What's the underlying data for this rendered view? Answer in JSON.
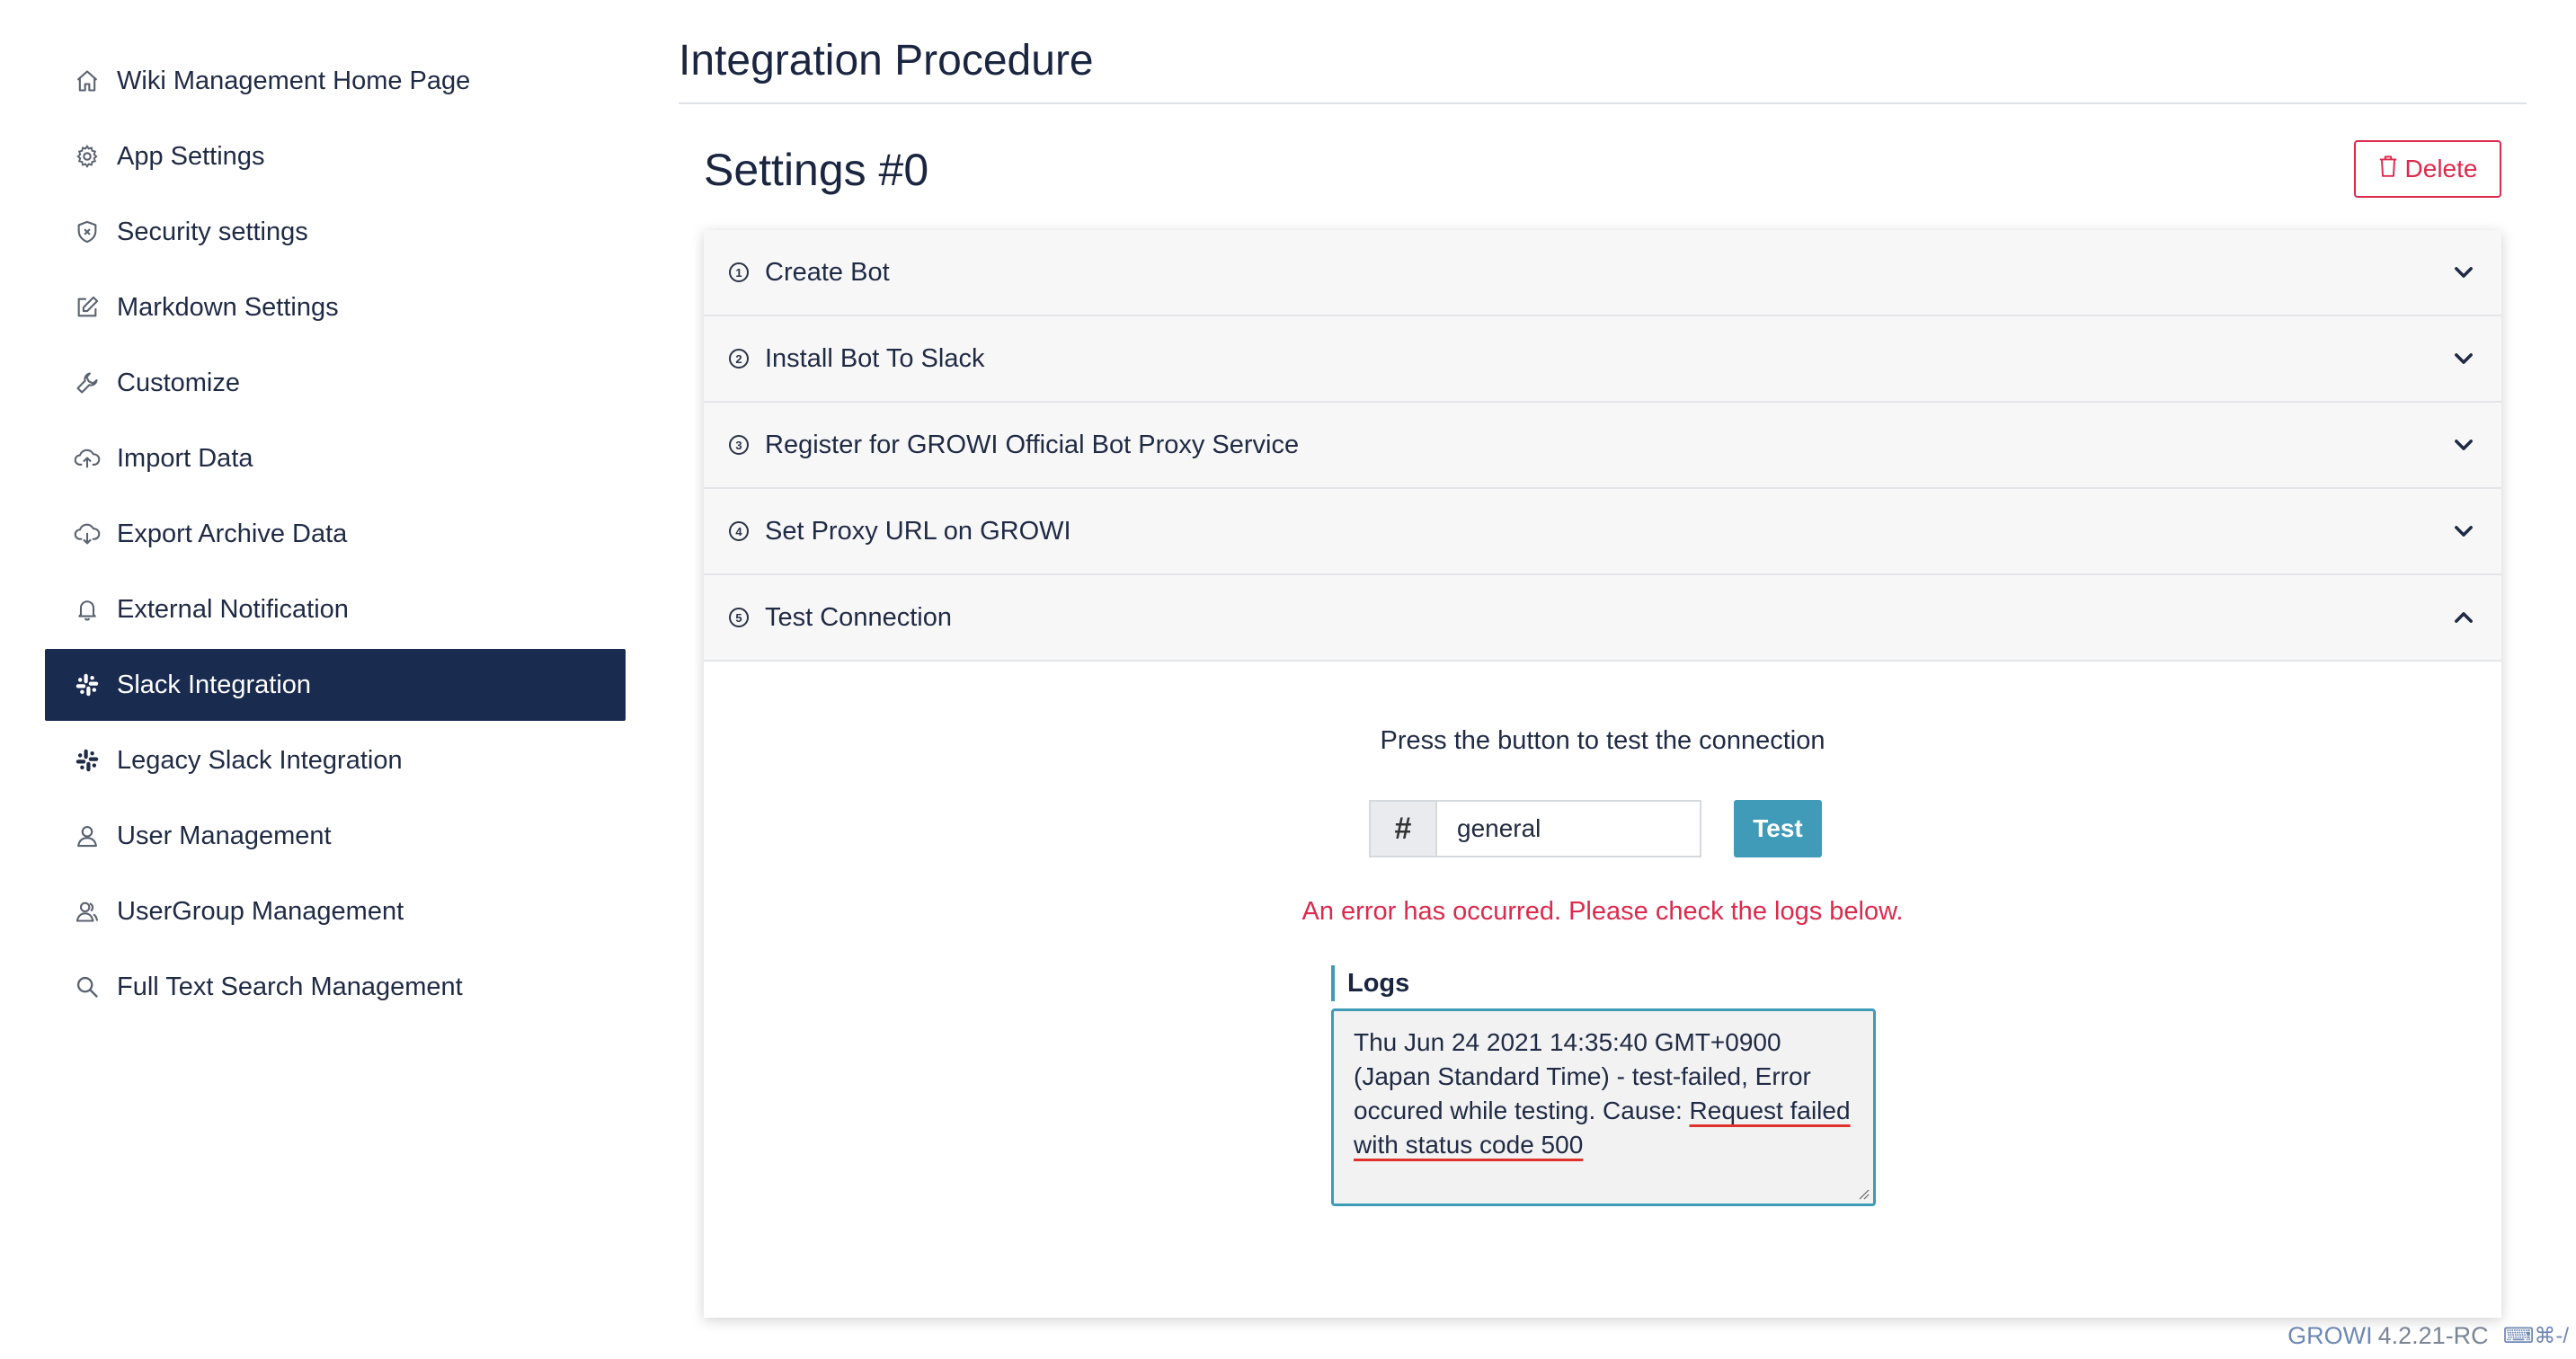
{
  "sidebar": {
    "items": [
      {
        "label": "Wiki Management Home Page",
        "icon": "home-icon"
      },
      {
        "label": "App Settings",
        "icon": "gear-icon"
      },
      {
        "label": "Security settings",
        "icon": "shield-icon"
      },
      {
        "label": "Markdown Settings",
        "icon": "edit-icon"
      },
      {
        "label": "Customize",
        "icon": "wrench-icon"
      },
      {
        "label": "Import Data",
        "icon": "cloud-upload-icon"
      },
      {
        "label": "Export Archive Data",
        "icon": "cloud-download-icon"
      },
      {
        "label": "External Notification",
        "icon": "bell-icon"
      },
      {
        "label": "Slack Integration",
        "icon": "slack-icon",
        "active": true
      },
      {
        "label": "Legacy Slack Integration",
        "icon": "slack-icon"
      },
      {
        "label": "User Management",
        "icon": "user-icon"
      },
      {
        "label": "UserGroup Management",
        "icon": "users-icon"
      },
      {
        "label": "Full Text Search Management",
        "icon": "search-icon"
      }
    ]
  },
  "main": {
    "title": "Integration Procedure",
    "settings_title": "Settings #0",
    "delete_label": "Delete",
    "steps": [
      {
        "number": "1",
        "label": "Create Bot",
        "expanded": false
      },
      {
        "number": "2",
        "label": "Install Bot To Slack",
        "expanded": false
      },
      {
        "number": "3",
        "label": "Register for GROWI Official Bot Proxy Service",
        "expanded": false
      },
      {
        "number": "4",
        "label": "Set Proxy URL on GROWI",
        "expanded": false
      },
      {
        "number": "5",
        "label": "Test Connection",
        "expanded": true
      }
    ],
    "test_connection": {
      "instruction": "Press the button to test the connection",
      "hash_symbol": "#",
      "channel_value": "general",
      "test_label": "Test",
      "error_message": "An error has occurred. Please check the logs below.",
      "logs_label": "Logs",
      "log_text_prefix": "Thu Jun 24 2021 14:35:40 GMT+0900 (Japan Standard Time) - test-failed, Error occured while testing. Cause: ",
      "log_text_error": "Request failed with status code 500"
    }
  },
  "footer": {
    "app_name": "GROWI",
    "version": "4.2.21-RC",
    "shortcut": "⌨⌘-/"
  },
  "colors": {
    "active_nav_bg": "#1a2b50",
    "danger": "#dc2a4c",
    "accent": "#3f9bb8"
  }
}
